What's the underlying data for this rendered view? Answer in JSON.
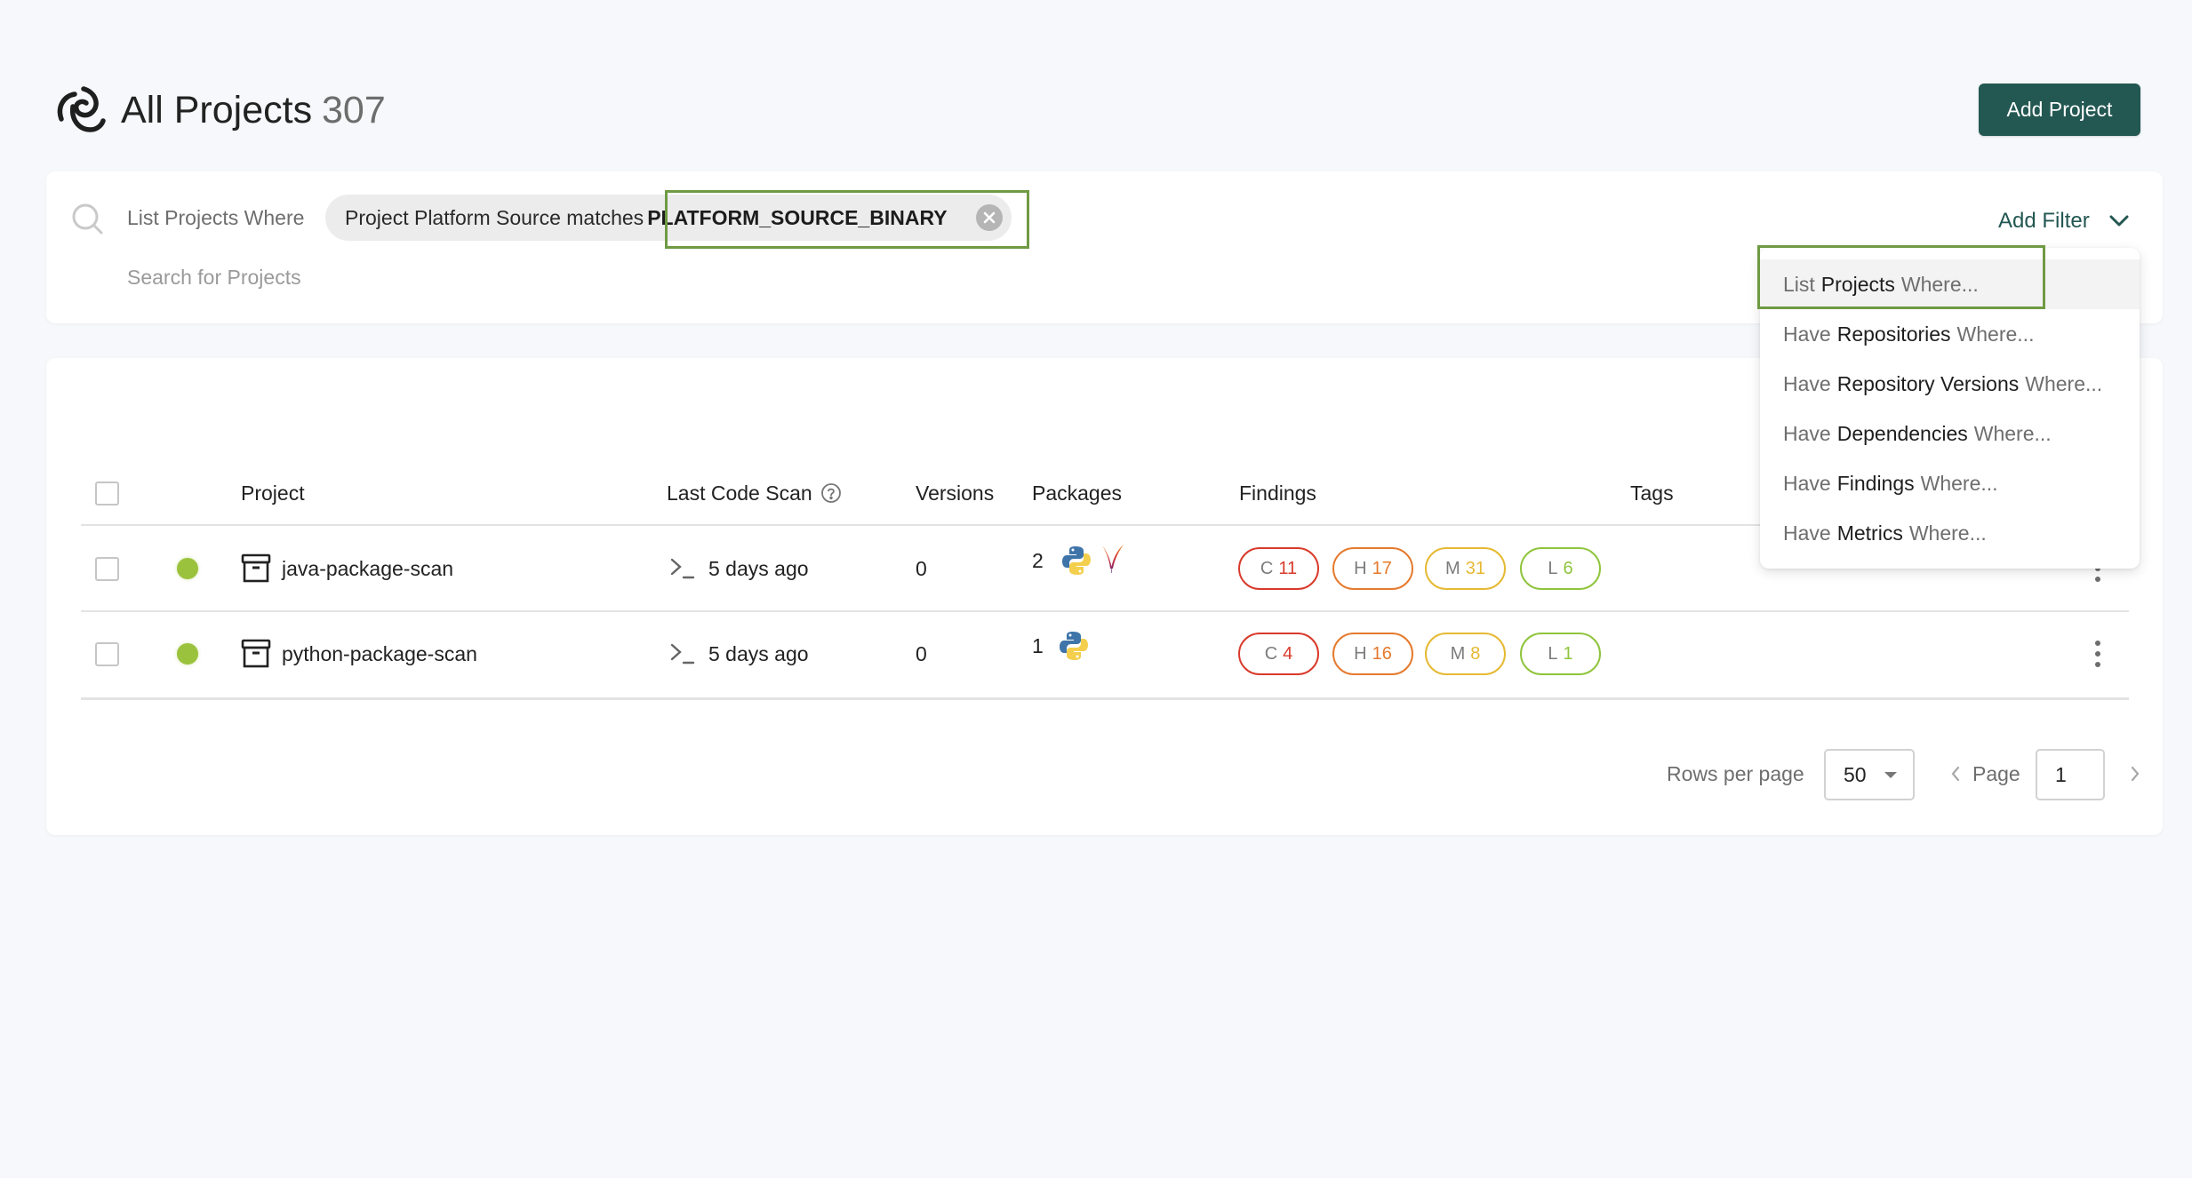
{
  "header": {
    "logo_icon": "swirl-logo-icon",
    "title": "All Projects",
    "count": "307",
    "add_project_label": "Add Project"
  },
  "filter_bar": {
    "search_icon": "search-icon",
    "prefix_label": "List Projects Where",
    "active_filter": {
      "field_text": "Project Platform Source matches",
      "value": "PLATFORM_SOURCE_BINARY",
      "remove_icon": "close-circle-icon"
    },
    "search_placeholder": "Search for Projects",
    "search_value": "",
    "add_filter_label": "Add Filter",
    "add_filter_icon": "chevron-down-icon"
  },
  "filter_menu": {
    "items": [
      {
        "prefix": "List",
        "entity": "Projects",
        "suffix": "Where...",
        "active": true
      },
      {
        "prefix": "Have",
        "entity": "Repositories",
        "suffix": "Where..."
      },
      {
        "prefix": "Have",
        "entity": "Repository Versions",
        "suffix": "Where..."
      },
      {
        "prefix": "Have",
        "entity": "Dependencies",
        "suffix": "Where..."
      },
      {
        "prefix": "Have",
        "entity": "Findings",
        "suffix": "Where..."
      },
      {
        "prefix": "Have",
        "entity": "Metrics",
        "suffix": "Where..."
      }
    ]
  },
  "table": {
    "columns": {
      "project": "Project",
      "last_code_scan": "Last Code Scan",
      "versions": "Versions",
      "packages": "Packages",
      "findings": "Findings",
      "tags": "Tags"
    },
    "rows": [
      {
        "status": "active",
        "status_color": "#9bc23c",
        "project_icon": "archive-box-icon",
        "name": "java-package-scan",
        "scan_icon": "terminal-prompt-icon",
        "last_code_scan": "5 days ago",
        "versions": "0",
        "packages_count": "2",
        "package_icons": [
          "python-icon",
          "apache-maven-feather-icon"
        ],
        "findings": {
          "C": "11",
          "H": "17",
          "M": "31",
          "L": "6"
        },
        "tags": ""
      },
      {
        "status": "active",
        "status_color": "#9bc23c",
        "project_icon": "archive-box-icon",
        "name": "python-package-scan",
        "scan_icon": "terminal-prompt-icon",
        "last_code_scan": "5 days ago",
        "versions": "0",
        "packages_count": "1",
        "package_icons": [
          "python-icon"
        ],
        "findings": {
          "C": "4",
          "H": "16",
          "M": "8",
          "L": "1"
        },
        "tags": ""
      }
    ]
  },
  "severity": {
    "C": {
      "label": "C",
      "color": "#d93a2b"
    },
    "H": {
      "label": "H",
      "color": "#e57a2e"
    },
    "M": {
      "label": "M",
      "color": "#e6b933"
    },
    "L": {
      "label": "L",
      "color": "#8fc43c"
    }
  },
  "pagination": {
    "rows_per_page_label": "Rows per page",
    "rows_per_page_value": "50",
    "page_label": "Page",
    "page_value": "1"
  },
  "colors": {
    "brand": "#235752",
    "highlight_outline": "#6f9a43",
    "background": "#f6f8fb"
  }
}
